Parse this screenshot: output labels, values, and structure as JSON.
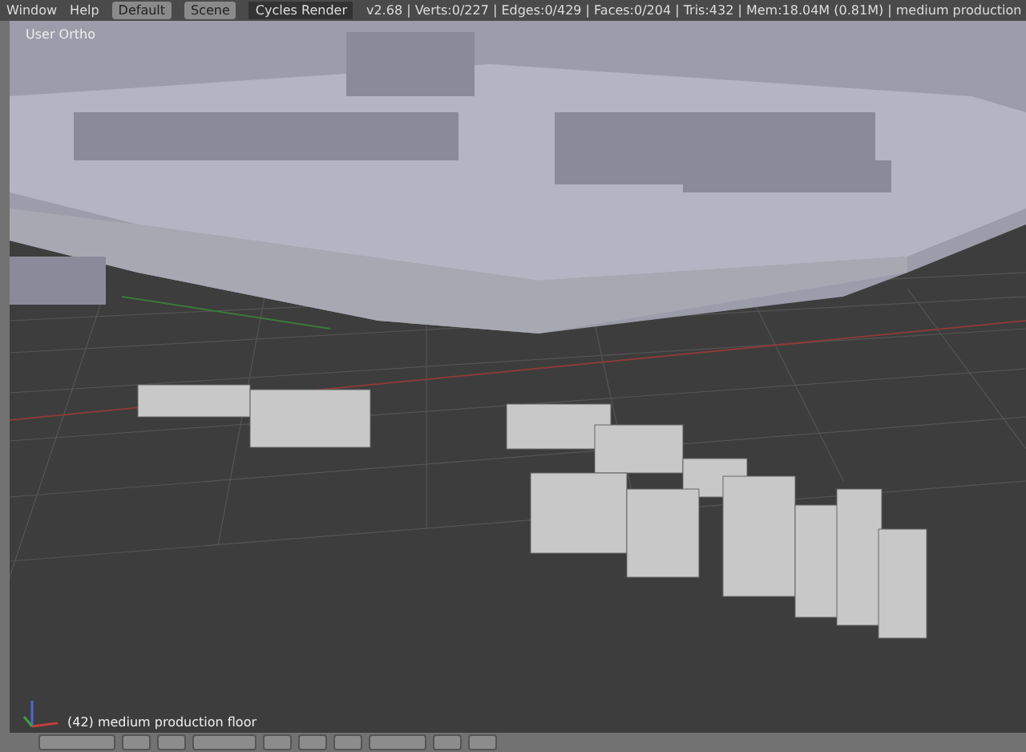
{
  "top_bar": {
    "menus": [
      "Window",
      "Help"
    ],
    "layout": "Default",
    "scene": "Scene",
    "render_engine": "Cycles Render",
    "stats": "v2.68 | Verts:0/227 | Edges:0/429 | Faces:0/204 | Tris:432 | Mem:18.04M (0.81M) | medium production"
  },
  "viewport": {
    "view_label": "User Ortho",
    "object_label": "(42) medium production floor"
  }
}
